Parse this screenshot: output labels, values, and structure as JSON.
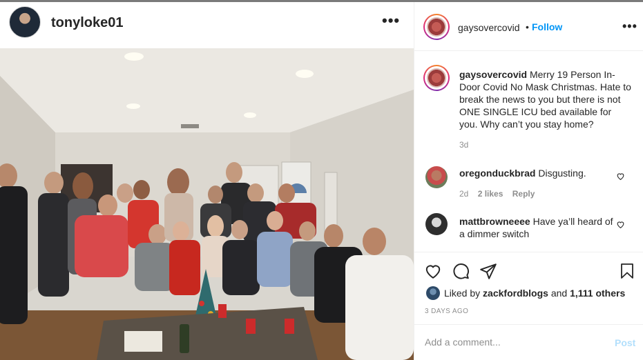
{
  "post": {
    "author": "tonyloke01",
    "more_icon": "ellipsis-icon"
  },
  "sidebar": {
    "account": "gaysovercovid",
    "dot": "•",
    "follow": "Follow",
    "caption_user": "gaysovercovid",
    "caption_text": "Merry 19 Person In-Door Covid No Mask Christmas. Hate to break the news to you but there is not ONE SINGLE ICU bed available for you. Why can’t you stay home?",
    "caption_time": "3d",
    "comments": [
      {
        "user": "oregonduckbrad",
        "text": "Disgusting.",
        "time": "2d",
        "likes": "2 likes",
        "reply": "Reply"
      },
      {
        "user": "mattbrowneeee",
        "text": "Have ya’ll heard of a dimmer switch"
      }
    ],
    "liked_prefix": "Liked by",
    "liked_user": "zackfordblogs",
    "liked_and": "and",
    "liked_others": "1,111 others",
    "date": "3 DAYS AGO",
    "comment_placeholder": "Add a comment...",
    "post_label": "Post"
  },
  "colors": {
    "link_blue": "#0095f6",
    "post_disabled": "#b2dffc",
    "muted": "#8e8e8e",
    "text": "#262626"
  }
}
